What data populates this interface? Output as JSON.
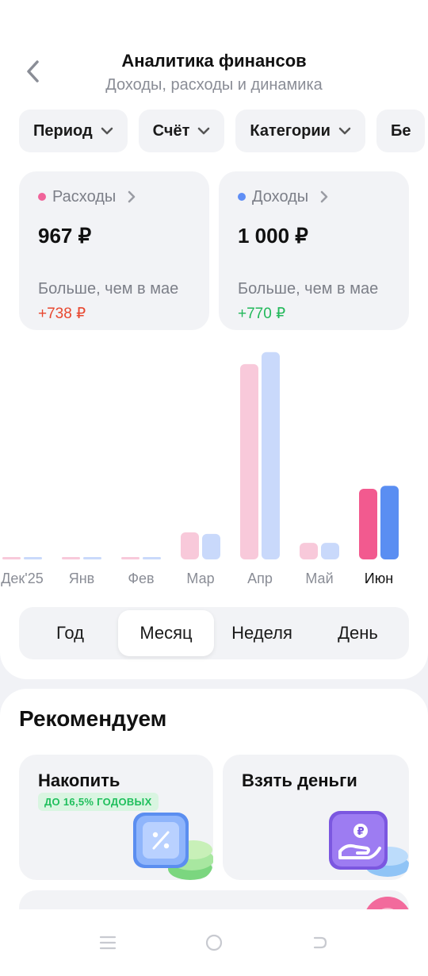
{
  "header": {
    "title": "Аналитика финансов",
    "subtitle": "Доходы, расходы и динамика"
  },
  "filters": [
    {
      "label": "Период"
    },
    {
      "label": "Счёт"
    },
    {
      "label": "Категории"
    },
    {
      "label": "Бе"
    }
  ],
  "summary": {
    "expenses": {
      "label": "Расходы",
      "amount": "967 ₽",
      "compare": "Больше, чем в мае",
      "delta": "+738 ₽",
      "dot_color": "#f0639a",
      "delta_color": "#e8472f"
    },
    "income": {
      "label": "Доходы",
      "amount": "1 000 ₽",
      "compare": "Больше, чем в мае",
      "delta": "+770 ₽",
      "dot_color": "#5f8ef5",
      "delta_color": "#22b85a"
    }
  },
  "chart_data": {
    "type": "bar",
    "categories": [
      "Дек'25",
      "Янв",
      "Фев",
      "Мар",
      "Апр",
      "Май",
      "Июн"
    ],
    "series": [
      {
        "values": [
          0,
          0,
          0,
          180,
          1300,
          110,
          470
        ]
      },
      {
        "values": [
          0,
          0,
          0,
          170,
          1380,
          110,
          490
        ]
      }
    ],
    "selected_category": "Июн",
    "colors": {
      "expenses": "#f8c9da",
      "income": "#c9d9fb",
      "expenses_active": "#f25a8f",
      "income_active": "#5a8ef2"
    }
  },
  "period_tabs": [
    {
      "label": "Год",
      "active": false
    },
    {
      "label": "Месяц",
      "active": true
    },
    {
      "label": "Неделя",
      "active": false
    },
    {
      "label": "День",
      "active": false
    }
  ],
  "recommend": {
    "title": "Рекомендуем",
    "cards": [
      {
        "title": "Накопить",
        "badge": "ДО 16,5% ГОДОВЫХ",
        "icon": "percent-icon"
      },
      {
        "title": "Взять деньги",
        "badge": "",
        "icon": "ruble-hand-icon"
      }
    ]
  }
}
